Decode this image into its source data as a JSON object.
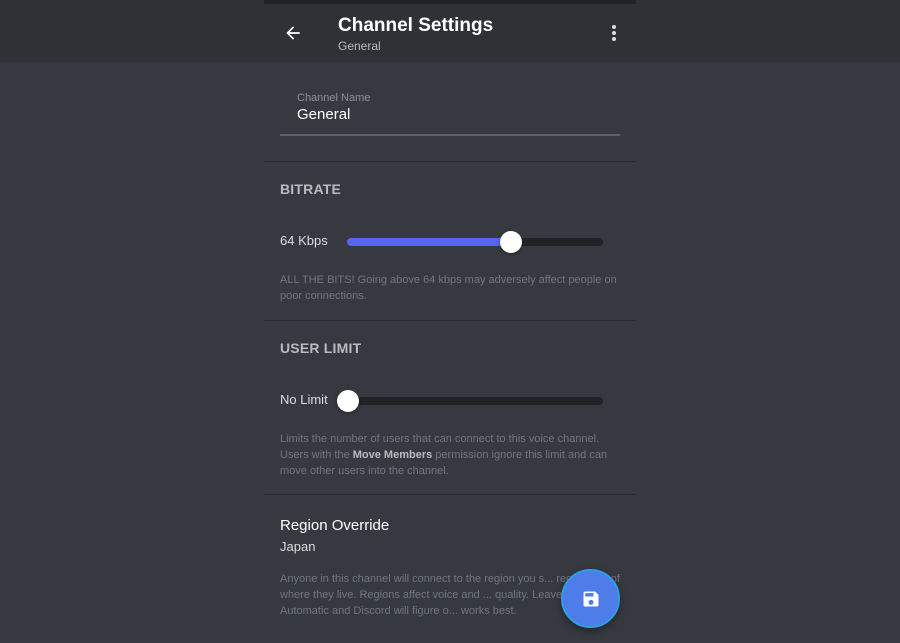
{
  "header": {
    "title": "Channel Settings",
    "subtitle": "General"
  },
  "channel_name": {
    "label": "Channel Name",
    "value": "General"
  },
  "bitrate": {
    "title": "BITRATE",
    "value_label": "64 Kbps",
    "level": 0.64,
    "help": "ALL THE BITS! Going above 64 kbps may adversely affect people on poor connections."
  },
  "user_limit": {
    "title": "USER LIMIT",
    "value_label": "No Limit",
    "level": 0,
    "help_before": "Limits the number of users that can connect to this voice channel. Users with the ",
    "help_bold": "Move Members",
    "help_after": " permission ignore this limit and can move other users into the channel."
  },
  "region": {
    "title": "Region Override",
    "value": "Japan",
    "help": "Anyone in this channel will connect to the region you s... regardless of where they live. Regions affect voice and ... quality. Leave it on Automatic and Discord will figure o... works best."
  },
  "colors": {
    "background": "#36393f",
    "header": "#2f3136",
    "accent": "#5865f2",
    "fab": "#4e7ce8"
  },
  "icons": {
    "back": "arrow-left-icon",
    "more": "vertical-ellipsis-icon",
    "save": "floppy-disk-icon"
  }
}
